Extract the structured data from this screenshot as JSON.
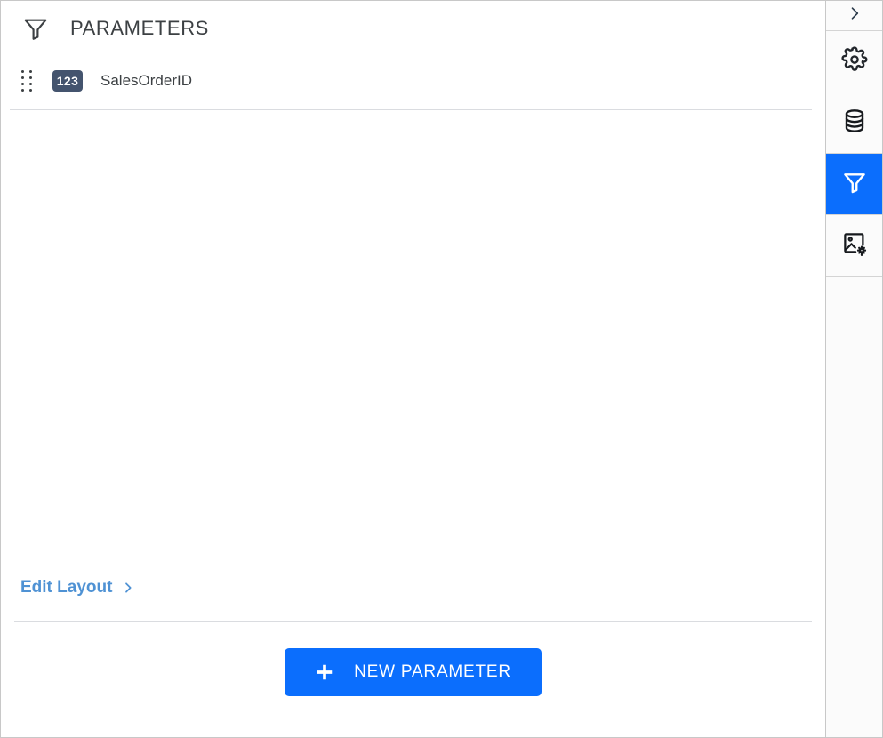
{
  "panel": {
    "title": "PARAMETERS",
    "header_icon": "filter-funnel-icon"
  },
  "parameters": [
    {
      "name": "SalesOrderID",
      "type_badge": "123",
      "type_badge_color": "#44546e",
      "drag_handle_icon": "drag-handle-dots-icon"
    }
  ],
  "links": {
    "edit_layout_label": "Edit Layout",
    "edit_layout_chevron_icon": "chevron-right-icon",
    "edit_layout_color": "#4f92d4"
  },
  "footer": {
    "new_parameter_label": "NEW PARAMETER",
    "new_parameter_icon": "plus-icon",
    "accent_color": "#0b6efd"
  },
  "right_rail": {
    "active_index": 3,
    "active_color": "#0b6efd",
    "items": [
      {
        "icon": "chevron-right-icon",
        "name": "expand-panel"
      },
      {
        "icon": "gear-icon",
        "name": "settings"
      },
      {
        "icon": "database-icon",
        "name": "data-source"
      },
      {
        "icon": "filter-funnel-icon",
        "name": "parameters"
      },
      {
        "icon": "image-settings-icon",
        "name": "image-settings"
      }
    ]
  }
}
